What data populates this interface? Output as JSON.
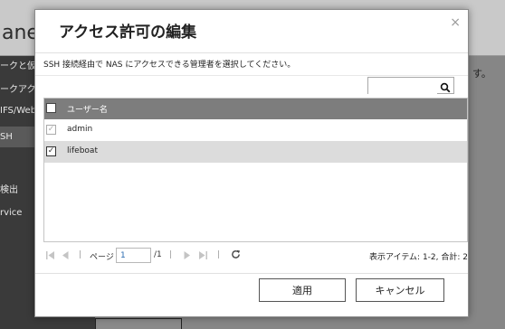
{
  "background": {
    "title": "anel",
    "sidebar_items": [
      "ークと仮想",
      "ークアクセ",
      "IFS/Web",
      "SH",
      "検出",
      "rvice"
    ],
    "right_text": "す。"
  },
  "modal": {
    "title": "アクセス許可の編集",
    "close_glyph": "×",
    "description": "SSH 接続経由で NAS にアクセスできる管理者を選択してください。",
    "search": {
      "value": "",
      "placeholder": ""
    },
    "table": {
      "header": "ユーザー名",
      "rows": [
        {
          "name": "admin",
          "checked": true,
          "disabled": true,
          "selected": false
        },
        {
          "name": "lifeboat",
          "checked": true,
          "disabled": false,
          "selected": true
        }
      ]
    },
    "pager": {
      "page_label": "ページ",
      "page_value": "1",
      "total": "/1",
      "info": "表示アイテム: 1-2, 合計: 2"
    },
    "buttons": {
      "apply": "適用",
      "cancel": "キャンセル"
    }
  },
  "icons": {
    "search": "magnifier-icon",
    "first": "first-page-icon",
    "prev": "prev-page-icon",
    "next": "next-page-icon",
    "last": "last-page-icon",
    "refresh": "refresh-icon"
  },
  "colors": {
    "table_header": "#7d7d7d",
    "selected_row": "#dcdcdc",
    "page_input_text": "#2a6ab0"
  }
}
